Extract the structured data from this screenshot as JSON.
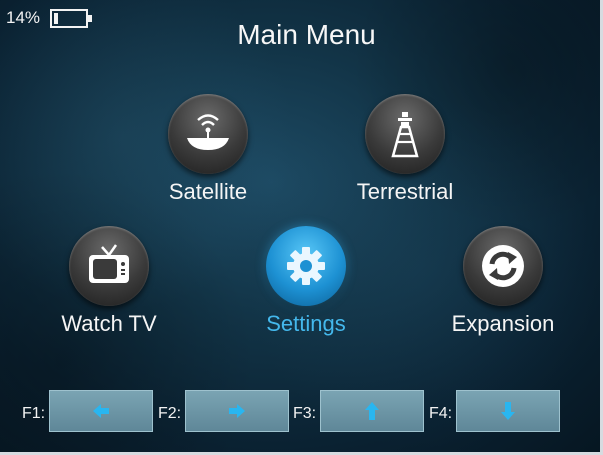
{
  "status": {
    "battery_percent": "14%",
    "battery_level": 0.14
  },
  "title": "Main Menu",
  "menu": {
    "satellite": {
      "label": "Satellite",
      "icon": "satellite-dish-icon"
    },
    "terrestrial": {
      "label": "Terrestrial",
      "icon": "antenna-tower-icon"
    },
    "watch_tv": {
      "label": "Watch TV",
      "icon": "tv-icon"
    },
    "settings": {
      "label": "Settings",
      "icon": "gear-icon",
      "selected": true
    },
    "expansion": {
      "label": "Expansion",
      "icon": "refresh-icon"
    }
  },
  "fkeys": [
    {
      "label": "F1:",
      "icon": "arrow-left-icon"
    },
    {
      "label": "F2:",
      "icon": "arrow-right-icon"
    },
    {
      "label": "F3:",
      "icon": "arrow-up-icon"
    },
    {
      "label": "F4:",
      "icon": "arrow-down-icon"
    }
  ],
  "colors": {
    "accent": "#44b8ec",
    "text": "#f5f5f5",
    "fkey_button": "#6c95a5",
    "arrow": "#29b6f0"
  }
}
